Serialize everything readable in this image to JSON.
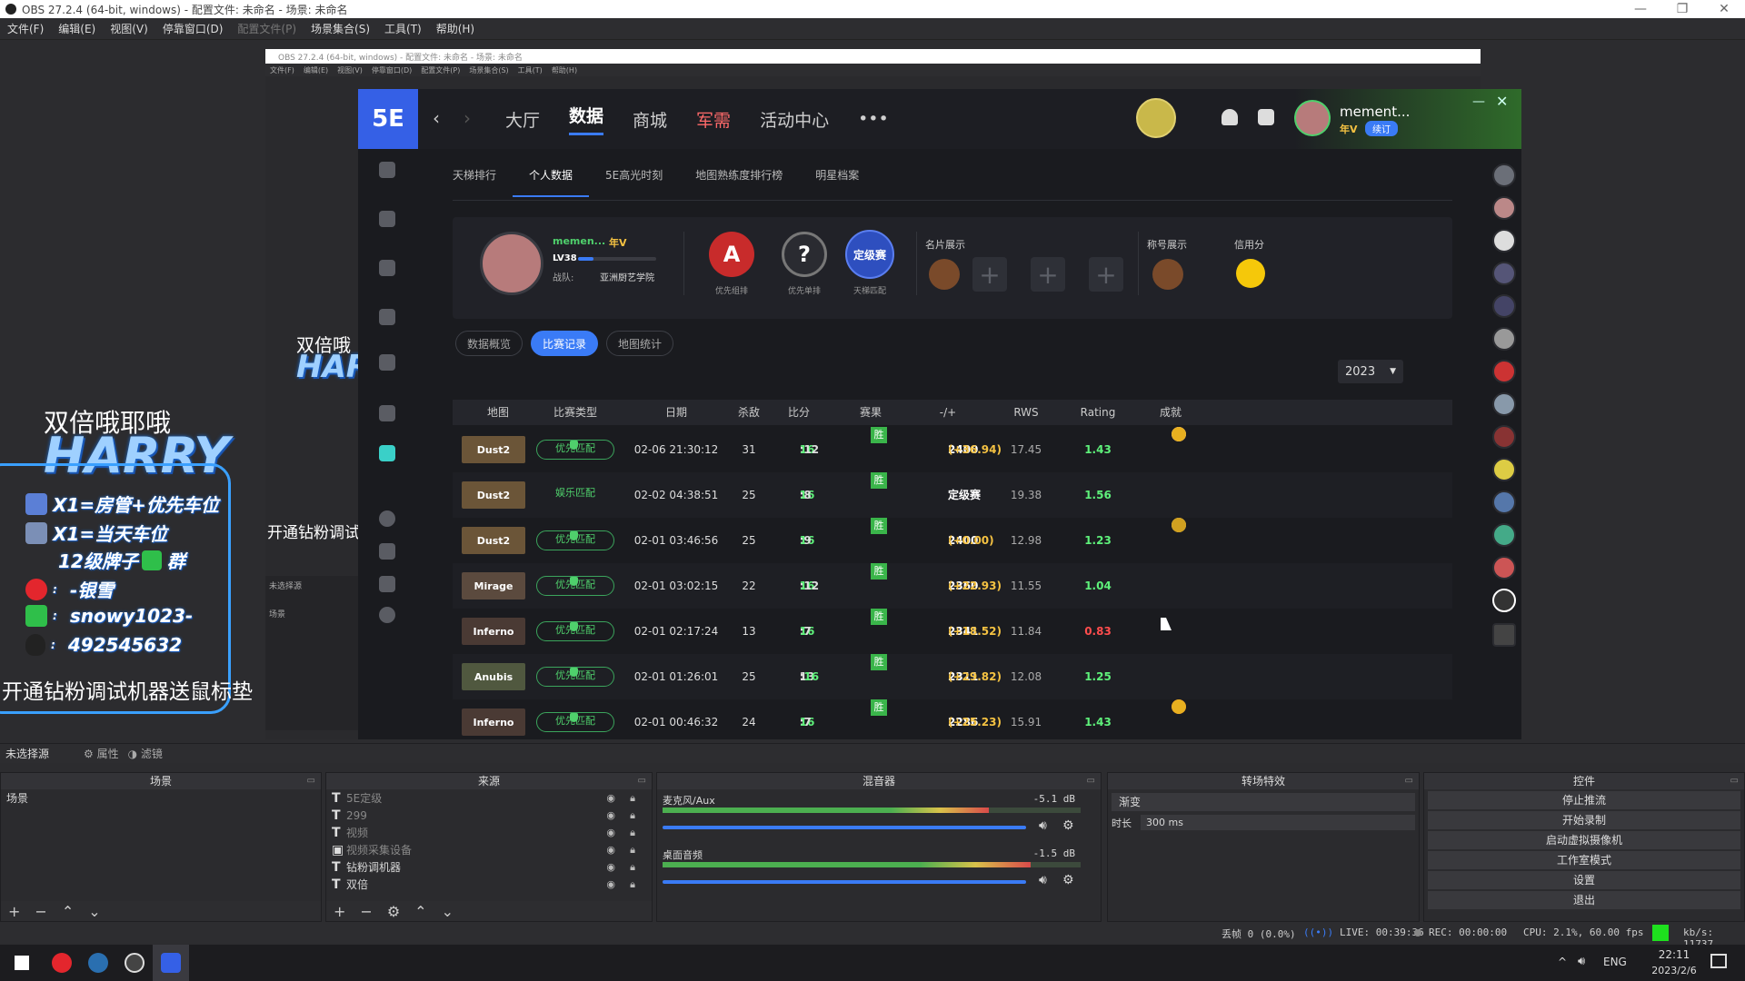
{
  "window": {
    "title": "OBS 27.2.4 (64-bit, windows) - 配置文件: 未命名 - 场景: 未命名",
    "controls": [
      "—",
      "❐",
      "✕"
    ]
  },
  "menu": [
    "文件(F)",
    "编辑(E)",
    "视图(V)",
    "停靠窗口(D)",
    "配置文件(P)",
    "场景集合(S)",
    "工具(T)",
    "帮助(H)"
  ],
  "nested": {
    "title": "OBS 27.2.4 (64-bit, windows) - 配置文件: 未命名 - 场景: 未命名",
    "menu": [
      "文件(F)",
      "编辑(E)",
      "视图(V)",
      "停靠窗口(D)",
      "配置文件(P)",
      "场景集合(S)",
      "工具(T)",
      "帮助(H)"
    ],
    "scene_label": "未选择源",
    "scene_item": "场景"
  },
  "overlay": {
    "title": "双倍哦耶哦",
    "harry": "HARRY",
    "lines": [
      "X1=房管+优先车位",
      "X1=当天车位",
      "12级牌子",
      "群",
      "-银雪",
      "snowy1023-",
      "492545632"
    ],
    "small_title": "双倍哦",
    "bottom": "开通钻粉调试机器送鼠标垫",
    "small_bottom": "开通钻粉调试"
  },
  "app": {
    "logo": "5E",
    "nav": [
      "大厅",
      "数据",
      "商城",
      "军需",
      "活动中心",
      "•••"
    ],
    "user": {
      "name": "mement...",
      "tag": "年V",
      "status": "续订"
    },
    "subtabs": [
      "天梯排行",
      "个人数据",
      "5E高光时刻",
      "地图熟练度排行榜",
      "明星档案"
    ],
    "profile": {
      "name": "memen...",
      "vip": "年V",
      "level": "LV38",
      "team_label": "战队:",
      "team": "亚洲厨艺学院",
      "rank_a": "A",
      "rank_a_label": "优先组排",
      "rank_q": "?",
      "rank_q_label": "优先单排",
      "rank_d": "定级赛",
      "rank_d_label": "天梯匹配",
      "card_label": "名片展示",
      "title_label": "称号展示",
      "credit_label": "信用分"
    },
    "pills": [
      "数据概览",
      "比赛记录",
      "地图统计"
    ],
    "year": "2023",
    "headers": [
      "地图",
      "比赛类型",
      "日期",
      "杀敌",
      "比分",
      "赛果",
      "-/+",
      "RWS",
      "Rating",
      "成就"
    ],
    "rows": [
      {
        "map": "Dust2",
        "type": "优先匹配",
        "date": "02-06 21:30:12",
        "kills": "31",
        "score_l": "16",
        "score_r": "12",
        "result": "胜",
        "elo": "2400",
        "delta": "(+36.94)",
        "rws": "17.45",
        "rating": "1.43"
      },
      {
        "map": "Dust2",
        "type": "娱乐匹配",
        "date": "02-02 04:38:51",
        "kills": "25",
        "score_l": "16",
        "score_r": "8",
        "result": "胜",
        "elo": "定级赛",
        "delta": "",
        "rws": "19.38",
        "rating": "1.56"
      },
      {
        "map": "Dust2",
        "type": "优先匹配",
        "date": "02-01 03:46:56",
        "kills": "25",
        "score_l": "16",
        "score_r": "9",
        "result": "胜",
        "elo": "2400",
        "delta": "(+0.00)",
        "rws": "12.98",
        "rating": "1.23"
      },
      {
        "map": "Mirage",
        "type": "优先匹配",
        "date": "02-01 03:02:15",
        "kills": "22",
        "score_l": "16",
        "score_r": "12",
        "result": "胜",
        "elo": "2360",
        "delta": "(+22.93)",
        "rws": "11.55",
        "rating": "1.04"
      },
      {
        "map": "Inferno",
        "type": "优先匹配",
        "date": "02-01 02:17:24",
        "kills": "13",
        "score_l": "16",
        "score_r": "7",
        "result": "胜",
        "elo": "2341",
        "delta": "(+18.52)",
        "rws": "11.84",
        "rating": "0.83"
      },
      {
        "map": "Anubis",
        "type": "优先匹配",
        "date": "02-01 01:26:01",
        "kills": "25",
        "score_l": "13",
        "score_r": "16",
        "result": "胜",
        "elo": "2311",
        "delta": "(+29.82)",
        "rws": "12.08",
        "rating": "1.25"
      },
      {
        "map": "Inferno",
        "type": "优先匹配",
        "date": "02-01 00:46:32",
        "kills": "24",
        "score_l": "16",
        "score_r": "7",
        "result": "胜",
        "elo": "2286",
        "delta": "(+25.23)",
        "rws": "15.91",
        "rating": "1.43"
      }
    ]
  },
  "obs": {
    "no_source": "未选择源",
    "props_btn": "属性",
    "filters_btn": "滤镜",
    "docks": {
      "scenes": "场景",
      "sources": "来源",
      "mixer": "混音器",
      "transitions": "转场特效",
      "controls": "控件"
    },
    "scene_items": [
      "场景"
    ],
    "sources": [
      "5E定级",
      "299",
      "视频",
      "视频采集设备",
      "钻粉调机器",
      "双倍"
    ],
    "mixer": [
      {
        "name": "麦克风/Aux",
        "db": "-5.1 dB",
        "level": 0.78
      },
      {
        "name": "桌面音频",
        "db": "-1.5 dB",
        "level": 0.88
      }
    ],
    "transition": "渐变",
    "duration_label": "时长",
    "duration": "300 ms",
    "controls": [
      "停止推流",
      "开始录制",
      "启动虚拟摄像机",
      "工作室模式",
      "设置",
      "退出"
    ],
    "status": {
      "dropped": "丢帧 0 (0.0%)",
      "live": "LIVE: 00:39:36",
      "rec": "REC: 00:00:00",
      "cpu": "CPU: 2.1%, 60.00 fps",
      "kbps": "kb/s: 11737"
    }
  },
  "taskbar": {
    "lang": "ENG",
    "time": "22:11",
    "date": "2023/2/6"
  }
}
